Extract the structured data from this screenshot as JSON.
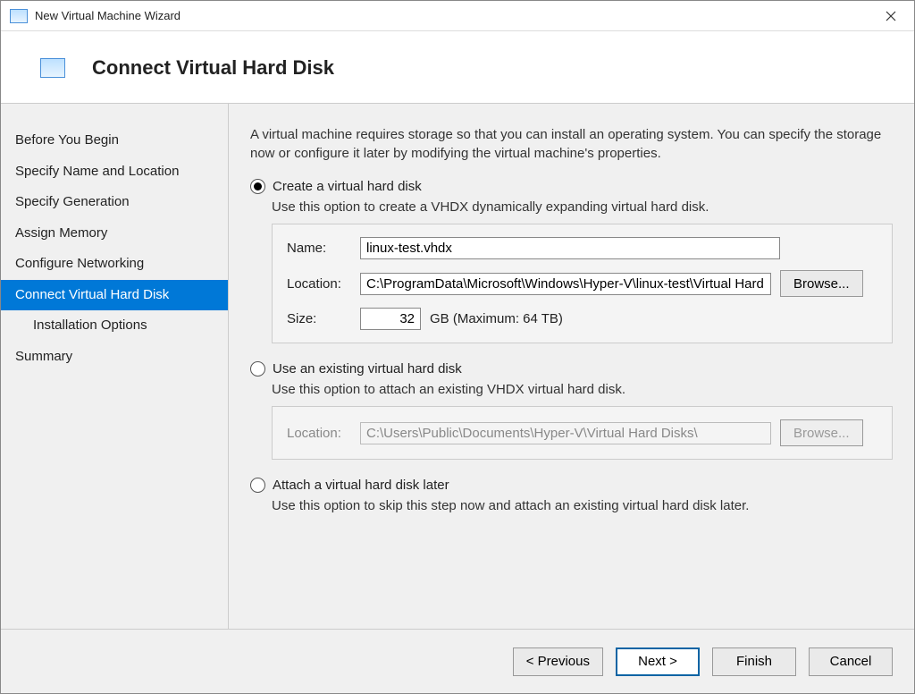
{
  "window": {
    "title": "New Virtual Machine Wizard"
  },
  "header": {
    "title": "Connect Virtual Hard Disk"
  },
  "sidebar": {
    "steps": [
      "Before You Begin",
      "Specify Name and Location",
      "Specify Generation",
      "Assign Memory",
      "Configure Networking",
      "Connect Virtual Hard Disk",
      "Installation Options",
      "Summary"
    ]
  },
  "intro": "A virtual machine requires storage so that you can install an operating system. You can specify the storage now or configure it later by modifying the virtual machine's properties.",
  "option_create": {
    "label": "Create a virtual hard disk",
    "desc": "Use this option to create a VHDX dynamically expanding virtual hard disk.",
    "name_label": "Name:",
    "name_value": "linux-test.vhdx",
    "location_label": "Location:",
    "location_value": "C:\\ProgramData\\Microsoft\\Windows\\Hyper-V\\linux-test\\Virtual Hard",
    "browse_label": "Browse...",
    "size_label": "Size:",
    "size_value": "32",
    "size_suffix": "GB (Maximum: 64 TB)"
  },
  "option_existing": {
    "label": "Use an existing virtual hard disk",
    "desc": "Use this option to attach an existing VHDX virtual hard disk.",
    "location_label": "Location:",
    "location_value": "C:\\Users\\Public\\Documents\\Hyper-V\\Virtual Hard Disks\\",
    "browse_label": "Browse..."
  },
  "option_later": {
    "label": "Attach a virtual hard disk later",
    "desc": "Use this option to skip this step now and attach an existing virtual hard disk later."
  },
  "footer": {
    "previous": "< Previous",
    "next": "Next >",
    "finish": "Finish",
    "cancel": "Cancel"
  }
}
